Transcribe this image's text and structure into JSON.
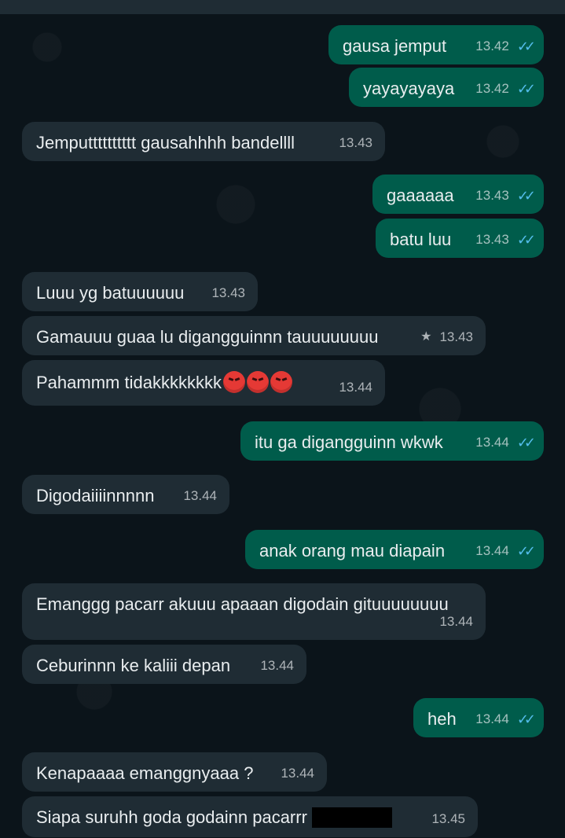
{
  "messages": [
    {
      "id": "m1",
      "dir": "out",
      "text": "gausa jemput",
      "time": "13.42",
      "ticks": "✓✓"
    },
    {
      "id": "m2",
      "dir": "out",
      "text": "yayayayaya",
      "time": "13.42",
      "ticks": "✓✓"
    },
    {
      "id": "m3",
      "dir": "in",
      "text": "Jemputttttttttt gausahhhh bandellll",
      "time": "13.43"
    },
    {
      "id": "m4",
      "dir": "out",
      "text": "gaaaaaa",
      "time": "13.43",
      "ticks": "✓✓"
    },
    {
      "id": "m5",
      "dir": "out",
      "text": "batu luu",
      "time": "13.43",
      "ticks": "✓✓"
    },
    {
      "id": "m6",
      "dir": "in",
      "text": "Luuu yg batuuuuuu",
      "time": "13.43"
    },
    {
      "id": "m7",
      "dir": "in",
      "text": "Gamauuu guaa lu digangguinnn tauuuuuuuu",
      "time": "13.43",
      "starred": "★"
    },
    {
      "id": "m8",
      "dir": "in",
      "text": "Pahammm tidakkkkkkkk",
      "time": "13.44",
      "emoji_count": 3
    },
    {
      "id": "m9",
      "dir": "out",
      "text": "itu ga digangguinn wkwk",
      "time": "13.44",
      "ticks": "✓✓"
    },
    {
      "id": "m10",
      "dir": "in",
      "text": "Digodaiiiinnnnn",
      "time": "13.44"
    },
    {
      "id": "m11",
      "dir": "out",
      "text": "anak orang mau diapain",
      "time": "13.44",
      "ticks": "✓✓"
    },
    {
      "id": "m12",
      "dir": "in",
      "text": "Emanggg pacarr akuuu apaaan digodain gituuuuuuuu",
      "time": "13.44"
    },
    {
      "id": "m13",
      "dir": "in",
      "text": "Ceburinnn ke kaliii depan",
      "time": "13.44"
    },
    {
      "id": "m14",
      "dir": "out",
      "text": "heh",
      "time": "13.44",
      "ticks": "✓✓"
    },
    {
      "id": "m15",
      "dir": "in",
      "text": "Kenapaaaa emanggnyaaa ?",
      "time": "13.44"
    },
    {
      "id": "m16",
      "dir": "in",
      "text": "Siapa suruhh goda godainn pacarrr",
      "time": "13.45",
      "redacted": true
    }
  ]
}
